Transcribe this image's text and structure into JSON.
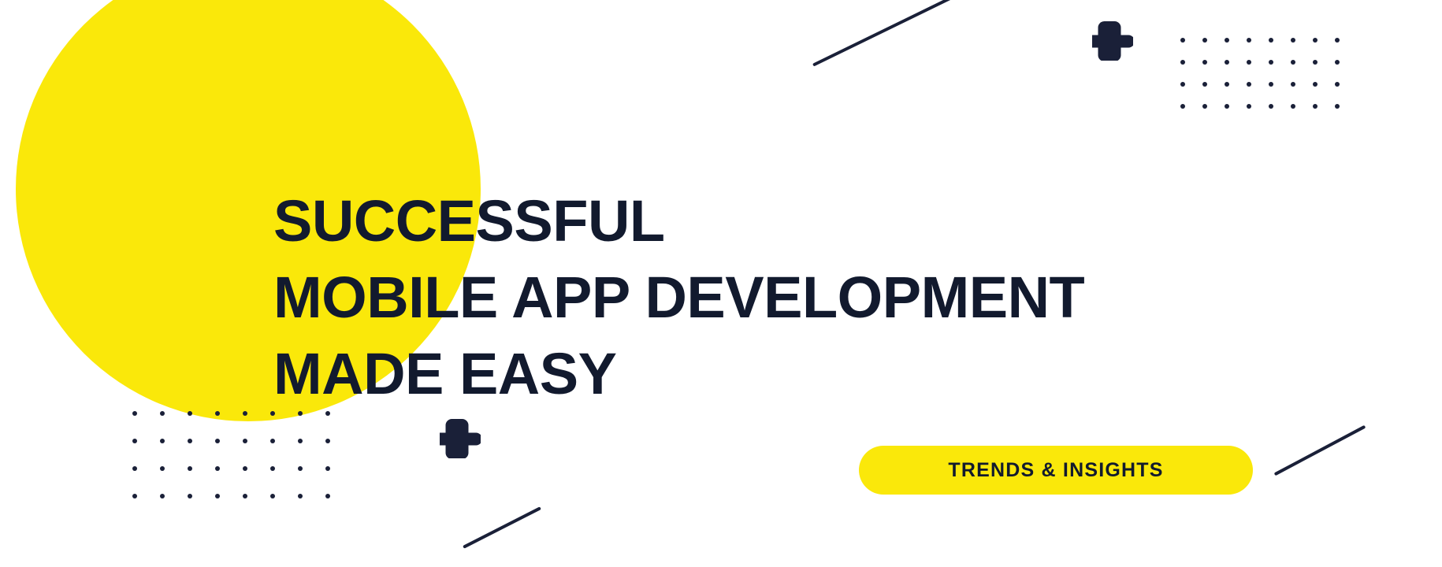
{
  "banner": {
    "background_color": "#ffffff",
    "accent_yellow": "#FAE80A",
    "ink_navy": "#121A2E",
    "decor_navy": "#1A2038"
  },
  "headline": {
    "lines": [
      "SUCCESSFUL",
      "MOBILE APP DEVELOPMENT",
      "MADE EASY"
    ]
  },
  "badge": {
    "label": "TRENDS & INSIGHTS",
    "background_color": "#FAE80A",
    "text_color": "#121A2E"
  },
  "decorations": {
    "circle": {
      "name": "yellow-circle",
      "color": "#FAE80A"
    },
    "dot_grids": [
      {
        "name": "dot-grid-top-right",
        "columns": 8,
        "rows": 4,
        "color": "#1A2038"
      },
      {
        "name": "dot-grid-bottom-left",
        "columns": 8,
        "rows": 4,
        "color": "#1A2038"
      }
    ],
    "plus_icons": [
      {
        "name": "plus-top-right",
        "color": "#1A2038"
      },
      {
        "name": "plus-bottom-left",
        "color": "#1A2038"
      }
    ],
    "diagonal_lines": [
      {
        "name": "diag-line-top",
        "color": "#1A2038"
      },
      {
        "name": "diag-line-bottom-center",
        "color": "#1A2038"
      },
      {
        "name": "diag-line-bottom-right",
        "color": "#1A2038"
      }
    ]
  }
}
